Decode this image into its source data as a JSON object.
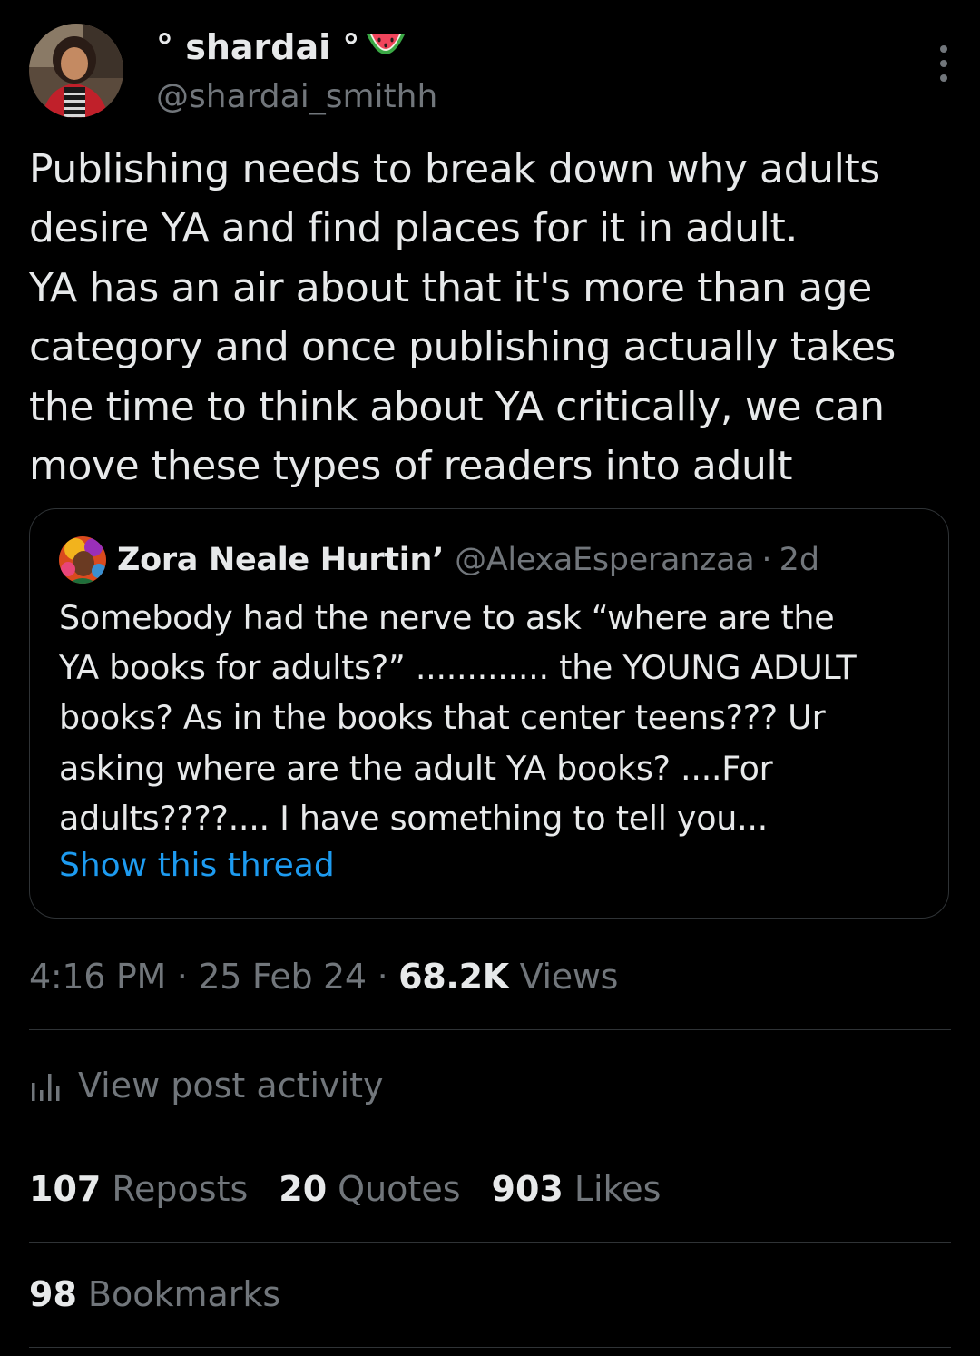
{
  "author": {
    "display_name": "° shardai °",
    "handle": "@shardai_smithh",
    "name_emoji_icon": "watermelon-icon"
  },
  "tweet": {
    "text": "Publishing needs to break down why adults\ndesire YA and find places for it in adult.\nYA has an air about that it's more than age\ncategory and once publishing actually takes\nthe time to think about YA critically, we can\nmove these types of readers into adult"
  },
  "quoted": {
    "name": "Zora Neale Hurtin’",
    "handle": "@AlexaEsperanzaa",
    "separator": "·",
    "time": "2d",
    "text": "Somebody had the nerve to ask “where are the\nYA books for adults?” ............. the YOUNG ADULT\nbooks? As in the books that center teens??? Ur\nasking where are the adult YA books? ....For\nadults????.... I have something to tell you...",
    "show_thread": "Show this thread"
  },
  "meta": {
    "time": "4:16 PM",
    "sep1": " · ",
    "date": "25 Feb 24",
    "sep2": " · ",
    "views_count": "68.2K",
    "views_label": " Views"
  },
  "activity": {
    "label": "View post activity"
  },
  "stats": {
    "reposts_count": "107",
    "reposts_label": "Reposts",
    "quotes_count": "20",
    "quotes_label": "Quotes",
    "likes_count": "903",
    "likes_label": "Likes",
    "bookmarks_count": "98",
    "bookmarks_label": "Bookmarks"
  },
  "colors": {
    "background": "#000000",
    "text_primary": "#e7e9ea",
    "text_secondary": "#71767b",
    "link": "#1d9bf0",
    "border": "#2f3336"
  }
}
